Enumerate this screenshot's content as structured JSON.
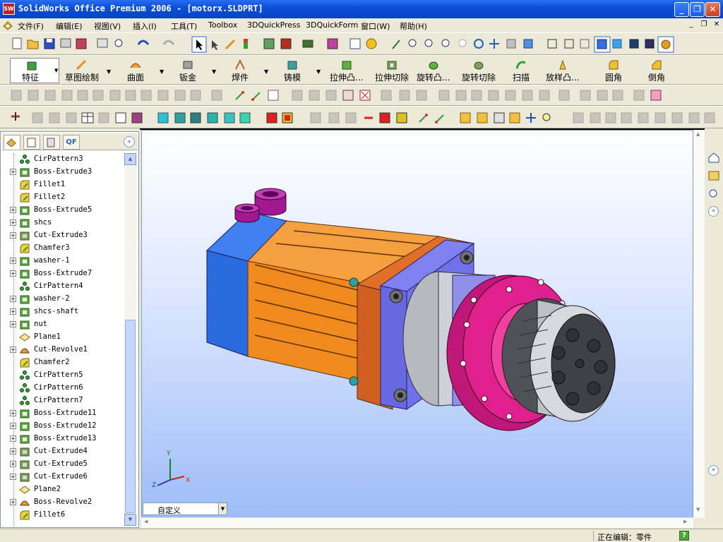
{
  "window": {
    "title": "SolidWorks Office Premium 2006 - [motorx.SLDPRT]",
    "app_icon_text": "SW"
  },
  "menu": {
    "items": [
      "文件(F)",
      "编辑(E)",
      "视图(V)",
      "插入(I)",
      "工具(T)",
      "Toolbox",
      "3DQuickPress",
      "3DQuickForm",
      "窗口(W)",
      "帮助(H)"
    ]
  },
  "features_toolbar": {
    "panel_label": "特征",
    "buttons": [
      "草图绘制",
      "曲面",
      "钣金",
      "焊件",
      "铸模",
      "拉伸凸...",
      "拉伸切除",
      "旋转凸...",
      "旋转切除",
      "扫描",
      "放样凸...",
      "圆角",
      "倒角"
    ]
  },
  "feature_manager": {
    "tabs": [
      "",
      "",
      "",
      "QF"
    ],
    "items": [
      {
        "label": "CirPattern3",
        "icon": "pattern-icon",
        "expandable": false
      },
      {
        "label": "Boss-Extrude3",
        "icon": "extrude-icon",
        "expandable": true
      },
      {
        "label": "Fillet1",
        "icon": "fillet-icon",
        "expandable": false
      },
      {
        "label": "Fillet2",
        "icon": "fillet-icon",
        "expandable": false
      },
      {
        "label": "Boss-Extrude5",
        "icon": "extrude-icon",
        "expandable": true
      },
      {
        "label": "shcs",
        "icon": "extrude-icon",
        "expandable": true
      },
      {
        "label": "Cut-Extrude3",
        "icon": "cut-icon",
        "expandable": true
      },
      {
        "label": "Chamfer3",
        "icon": "fillet-icon",
        "expandable": false
      },
      {
        "label": "washer-1",
        "icon": "extrude-icon",
        "expandable": true
      },
      {
        "label": "Boss-Extrude7",
        "icon": "extrude-icon",
        "expandable": true
      },
      {
        "label": "CirPattern4",
        "icon": "pattern-icon",
        "expandable": false
      },
      {
        "label": "washer-2",
        "icon": "extrude-icon",
        "expandable": true
      },
      {
        "label": "shcs-shaft",
        "icon": "extrude-icon",
        "expandable": true
      },
      {
        "label": "nut",
        "icon": "extrude-icon",
        "expandable": true
      },
      {
        "label": "Plane1",
        "icon": "plane-icon",
        "expandable": false
      },
      {
        "label": "Cut-Revolve1",
        "icon": "revolve-icon",
        "expandable": true
      },
      {
        "label": "Chamfer2",
        "icon": "fillet-icon",
        "expandable": false
      },
      {
        "label": "CirPattern5",
        "icon": "pattern-icon",
        "expandable": false
      },
      {
        "label": "CirPattern6",
        "icon": "pattern-icon",
        "expandable": false
      },
      {
        "label": "CirPattern7",
        "icon": "pattern-icon",
        "expandable": false
      },
      {
        "label": "Boss-Extrude11",
        "icon": "extrude-icon",
        "expandable": true
      },
      {
        "label": "Boss-Extrude12",
        "icon": "extrude-icon",
        "expandable": true
      },
      {
        "label": "Boss-Extrude13",
        "icon": "extrude-icon",
        "expandable": true
      },
      {
        "label": "Cut-Extrude4",
        "icon": "cut-icon",
        "expandable": true
      },
      {
        "label": "Cut-Extrude5",
        "icon": "cut-icon",
        "expandable": true
      },
      {
        "label": "Cut-Extrude6",
        "icon": "cut-icon",
        "expandable": true
      },
      {
        "label": "Plane2",
        "icon": "plane-icon",
        "expandable": false
      },
      {
        "label": "Boss-Revolve2",
        "icon": "revolve-icon",
        "expandable": true
      },
      {
        "label": "Fillet6",
        "icon": "fillet-icon",
        "expandable": false
      }
    ]
  },
  "viewport": {
    "configuration": "自定义",
    "triad": {
      "x": "X",
      "y": "Y",
      "z": "Z"
    }
  },
  "status": {
    "text": "正在编辑：零件",
    "help": "?"
  },
  "colors": {
    "motor_body": "#f08a1e",
    "end_cap": "#2a6ce0",
    "flange": "#7070e8",
    "hub": "#e0208c",
    "connector": "#a01890"
  }
}
